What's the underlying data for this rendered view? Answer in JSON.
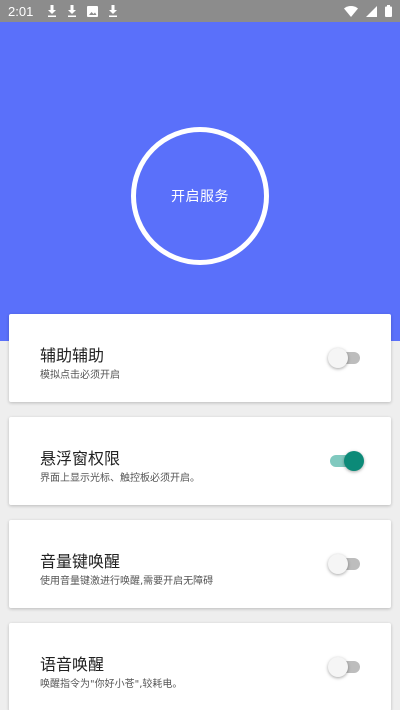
{
  "status_bar": {
    "time": "2:01",
    "icons": [
      "download-icon",
      "download-icon",
      "image-notification-icon",
      "download-icon",
      "wifi-icon",
      "signal-icon",
      "battery-icon"
    ]
  },
  "hero": {
    "service_button_label": "开启服务",
    "background_color": "#5a70fa"
  },
  "settings": [
    {
      "title": "辅助辅助",
      "description": "模拟点击必须开启",
      "enabled": false
    },
    {
      "title": "悬浮窗权限",
      "description": "界面上显示光标、触控板必须开启。",
      "enabled": true
    },
    {
      "title": "音量键唤醒",
      "description": "使用音量键激进行唤醒,需要开启无障碍",
      "enabled": false
    },
    {
      "title": "语音唤醒",
      "description": "唤醒指令为\"你好小苍\",较耗电。",
      "enabled": false
    }
  ],
  "colors": {
    "accent": "#0c8a78",
    "accent_track": "#80c9bf",
    "switch_off_track": "#bdbdbd"
  }
}
